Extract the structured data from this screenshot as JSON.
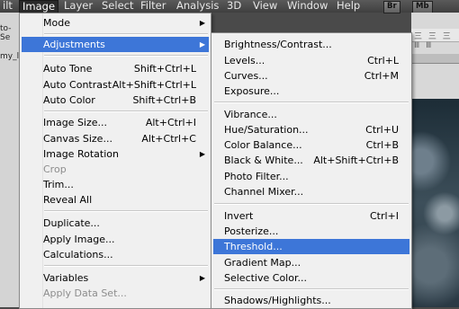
{
  "menubar": {
    "items": [
      "ilt",
      "Image",
      "Layer",
      "Select",
      "Filter",
      "Analysis",
      "3D",
      "View",
      "Window",
      "Help"
    ],
    "badges": [
      "Br",
      "Mb"
    ]
  },
  "left_strip": {
    "text1": "to-Se",
    "text2": "my_l"
  },
  "background": {
    "toolbar_glyphs": "三 三 三 Ⅲ Ⅲ"
  },
  "image_menu": {
    "mode": "Mode",
    "adjustments": "Adjustments",
    "auto_tone": {
      "label": "Auto Tone",
      "shortcut": "Shift+Ctrl+L"
    },
    "auto_contrast": {
      "label": "Auto Contrast",
      "shortcut": "Alt+Shift+Ctrl+L"
    },
    "auto_color": {
      "label": "Auto Color",
      "shortcut": "Shift+Ctrl+B"
    },
    "image_size": {
      "label": "Image Size...",
      "shortcut": "Alt+Ctrl+I"
    },
    "canvas_size": {
      "label": "Canvas Size...",
      "shortcut": "Alt+Ctrl+C"
    },
    "image_rotation": "Image Rotation",
    "crop": "Crop",
    "trim": "Trim...",
    "reveal_all": "Reveal All",
    "duplicate": "Duplicate...",
    "apply_image": "Apply Image...",
    "calculations": "Calculations...",
    "variables": "Variables",
    "apply_data_set": "Apply Data Set..."
  },
  "adjustments_menu": {
    "brightness_contrast": {
      "label": "Brightness/Contrast...",
      "shortcut": ""
    },
    "levels": {
      "label": "Levels...",
      "shortcut": "Ctrl+L"
    },
    "curves": {
      "label": "Curves...",
      "shortcut": "Ctrl+M"
    },
    "exposure": {
      "label": "Exposure...",
      "shortcut": ""
    },
    "vibrance": {
      "label": "Vibrance...",
      "shortcut": ""
    },
    "hue_saturation": {
      "label": "Hue/Saturation...",
      "shortcut": "Ctrl+U"
    },
    "color_balance": {
      "label": "Color Balance...",
      "shortcut": "Ctrl+B"
    },
    "black_white": {
      "label": "Black & White...",
      "shortcut": "Alt+Shift+Ctrl+B"
    },
    "photo_filter": {
      "label": "Photo Filter...",
      "shortcut": ""
    },
    "channel_mixer": {
      "label": "Channel Mixer...",
      "shortcut": ""
    },
    "invert": {
      "label": "Invert",
      "shortcut": "Ctrl+I"
    },
    "posterize": {
      "label": "Posterize...",
      "shortcut": ""
    },
    "threshold": {
      "label": "Threshold...",
      "shortcut": ""
    },
    "gradient_map": {
      "label": "Gradient Map...",
      "shortcut": ""
    },
    "selective_color": {
      "label": "Selective Color...",
      "shortcut": ""
    },
    "shadows_highlights": {
      "label": "Shadows/Highlights...",
      "shortcut": ""
    }
  },
  "colors": {
    "highlight": "#3d76d8",
    "menu_bg": "#f0f0f0",
    "menubar_bg": "#4a4a4a"
  }
}
